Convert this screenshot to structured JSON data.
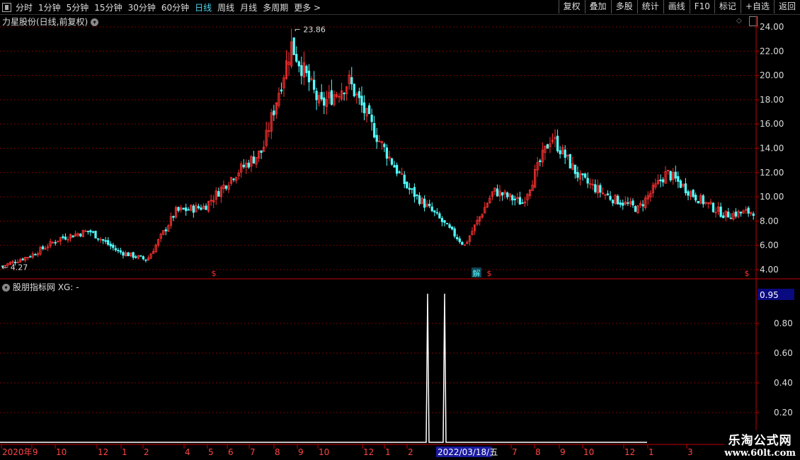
{
  "toolbar": {
    "periods": [
      "分时",
      "1分钟",
      "5分钟",
      "15分钟",
      "30分钟",
      "60分钟",
      "日线",
      "周线",
      "月线",
      "多周期",
      "更多 >"
    ],
    "active_index": 6,
    "right_buttons": [
      "复权",
      "叠加",
      "多股",
      "统计",
      "画线",
      "F10",
      "标记",
      "+自选",
      "返回"
    ]
  },
  "main_chart": {
    "title": "力星股份(日线,前复权)",
    "high_label": "23.86",
    "low_label": "4.27",
    "y_ticks": [
      "24.00",
      "22.00",
      "20.00",
      "18.00",
      "16.00",
      "14.00",
      "12.00",
      "10.00",
      "8.00",
      "6.00",
      "4.00"
    ],
    "markers": [
      "$",
      "解",
      "$",
      "$"
    ],
    "colors": {
      "up": "#ff3232",
      "down": "#54ffff",
      "grid": "#7a0000",
      "axis": "#c00000"
    }
  },
  "indicator": {
    "title": "股朋指标网 XG: -",
    "current_value": "0.95",
    "y_ticks": [
      "0.80",
      "0.60",
      "0.40",
      "0.20"
    ]
  },
  "x_axis": {
    "labels": [
      "2020年",
      "9",
      "10",
      "12",
      "1",
      "2",
      "4",
      "5",
      "6",
      "7",
      "8",
      "9",
      "10",
      "12",
      "1",
      "2",
      "7",
      "8",
      "9",
      "10",
      "12",
      "1",
      "3"
    ],
    "cursor_date": "2022/03/18/五"
  },
  "watermark": {
    "line1": "乐淘公式网",
    "line2": "www.60lt.com"
  },
  "chart_data": {
    "type": "line",
    "title": "力星股份(日线,前复权)",
    "ylim": [
      4,
      24
    ],
    "x": [
      "2020年",
      "9",
      "10",
      "12",
      "1",
      "2",
      "4",
      "5",
      "6",
      "7",
      "8",
      "9",
      "10",
      "12",
      "1",
      "2",
      "2022/03/18/五",
      "7",
      "8",
      "9",
      "10",
      "12",
      "1",
      "3"
    ],
    "series": [
      {
        "name": "力星股份",
        "values": [
          4.3,
          5.2,
          6.6,
          7.2,
          5.5,
          4.8,
          8.8,
          9.2,
          11.8,
          13.8,
          22.5,
          17.5,
          19.5,
          14.8,
          10.8,
          8.5,
          6.0,
          10.5,
          9.5,
          15.0,
          11.5,
          10.0,
          9.0,
          12.0,
          10.0,
          8.5,
          8.8
        ]
      }
    ],
    "indicator_series": {
      "name": "XG",
      "signals": [
        0,
        0,
        0,
        0,
        0,
        0,
        0,
        0,
        0,
        0,
        0,
        0,
        0,
        0,
        0,
        1,
        1,
        0,
        0,
        0,
        0,
        0,
        0,
        0,
        0
      ],
      "ylim": [
        0,
        1
      ]
    }
  }
}
